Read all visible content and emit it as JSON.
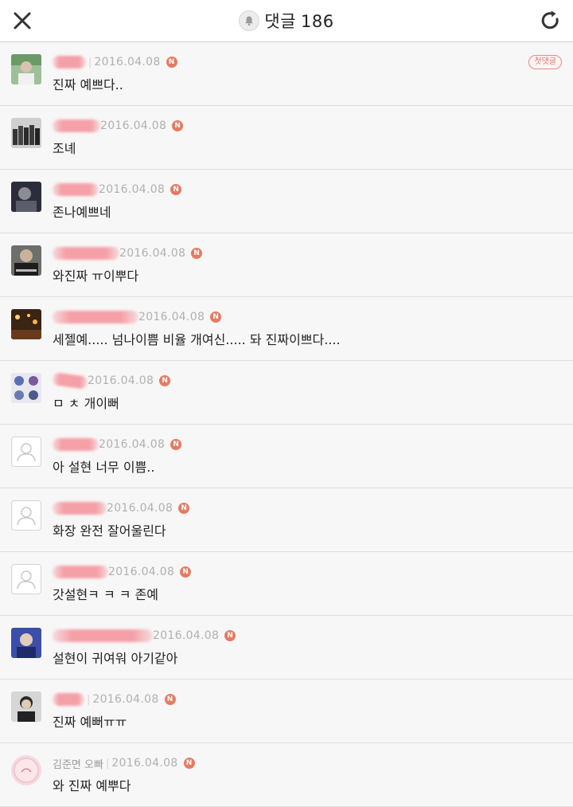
{
  "header": {
    "title": "댓글",
    "count": "186",
    "close_icon": "close-icon",
    "refresh_icon": "refresh-icon",
    "bell_icon": "bell-icon"
  },
  "colors": {
    "accent": "#e67b62",
    "badge_border": "#e88a86",
    "date": "#b0b0b0"
  },
  "comments": [
    {
      "nick": "",
      "date": "2016.04.08",
      "new_badge": "N",
      "text": "진짜 예쁘다..",
      "badge": "첫댓글"
    },
    {
      "nick": "",
      "date": "2016.04.08",
      "new_badge": "N",
      "text": "조녜"
    },
    {
      "nick": "",
      "date": "2016.04.08",
      "new_badge": "N",
      "text": "존나예쁘네"
    },
    {
      "nick": "",
      "date": "2016.04.08",
      "new_badge": "N",
      "text": "와진짜 ㅠ이뿌다"
    },
    {
      "nick": "",
      "date": "2016.04.08",
      "new_badge": "N",
      "text": "세젤예..... 넘나이쁨 비율 개여신..... 돠 진짜이쁘다...."
    },
    {
      "nick": "",
      "date": "2016.04.08",
      "new_badge": "N",
      "text": "ㅁ ㅊ 개이뻐"
    },
    {
      "nick": "",
      "date": "2016.04.08",
      "new_badge": "N",
      "text": "아 설현 너무 이쁨.."
    },
    {
      "nick": "",
      "date": "2016.04.08",
      "new_badge": "N",
      "text": "화장 완전 잘어울린다"
    },
    {
      "nick": "",
      "date": "2016.04.08",
      "new_badge": "N",
      "text": "갓설현ㅋ ㅋ ㅋ 존예"
    },
    {
      "nick": "",
      "date": "2016.04.08",
      "new_badge": "N",
      "text": "설현이 귀여워 아기같아"
    },
    {
      "nick": "",
      "date": "2016.04.08",
      "new_badge": "N",
      "text": "진짜 예뻐ㅠㅠ"
    },
    {
      "nick": "김준면 오빠",
      "date": "2016.04.08",
      "new_badge": "N",
      "text": "와 진짜 예뿌다"
    }
  ]
}
